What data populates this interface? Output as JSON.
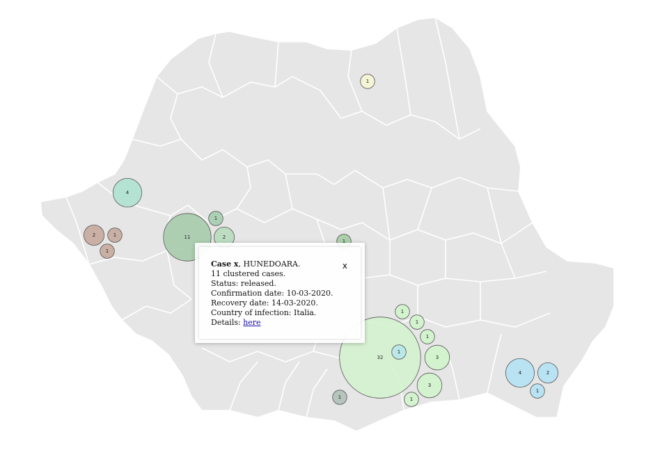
{
  "map": {
    "colors": {
      "land": "#e6e6e6",
      "borders": "#ffffff",
      "bubble_stroke": "#555555"
    },
    "clusters": [
      {
        "label": "1",
        "value": 1,
        "color": "#f4f4d6"
      },
      {
        "label": "4",
        "value": 4,
        "color": "#b2e3d2"
      },
      {
        "label": "1",
        "value": 1,
        "color": "#a9cfb0"
      },
      {
        "label": "11",
        "value": 11,
        "color": "#a3c9a8"
      },
      {
        "label": "2",
        "value": 2,
        "color": "#b9dcbf"
      },
      {
        "label": "2",
        "value": 2,
        "color": "#c8ada0"
      },
      {
        "label": "1",
        "value": 1,
        "color": "#c8ada0"
      },
      {
        "label": "1",
        "value": 1,
        "color": "#c8ada0"
      },
      {
        "label": "1",
        "value": 1,
        "color": "#a9cfa8"
      },
      {
        "label": "32",
        "value": 32,
        "color": "#d2f2cc"
      },
      {
        "label": "1",
        "value": 1,
        "color": "#d2f2cc"
      },
      {
        "label": "1",
        "value": 1,
        "color": "#d2f2cc"
      },
      {
        "label": "1",
        "value": 1,
        "color": "#d2f2cc"
      },
      {
        "label": "3",
        "value": 3,
        "color": "#d2f2cc"
      },
      {
        "label": "3",
        "value": 3,
        "color": "#d2f2cc"
      },
      {
        "label": "1",
        "value": 1,
        "color": "#b9e6ea"
      },
      {
        "label": "1",
        "value": 1,
        "color": "#d2f2cc"
      },
      {
        "label": "1",
        "value": 1,
        "color": "#b2c3bb"
      },
      {
        "label": "4",
        "value": 4,
        "color": "#b6e2f2"
      },
      {
        "label": "2",
        "value": 2,
        "color": "#b6e2f2"
      },
      {
        "label": "1",
        "value": 1,
        "color": "#b6e2f2"
      }
    ]
  },
  "popup": {
    "case_label": "Case x",
    "county": ", HUNEDOARA.",
    "clustered": "11 clustered cases.",
    "status": "Status: released.",
    "confirmation": "Confirmation date: 10-03-2020.",
    "recovery": "Recovery date: 14-03-2020.",
    "country": "Country of infection: Italia.",
    "details_prefix": "Details: ",
    "details_link": "here",
    "close": "x"
  }
}
